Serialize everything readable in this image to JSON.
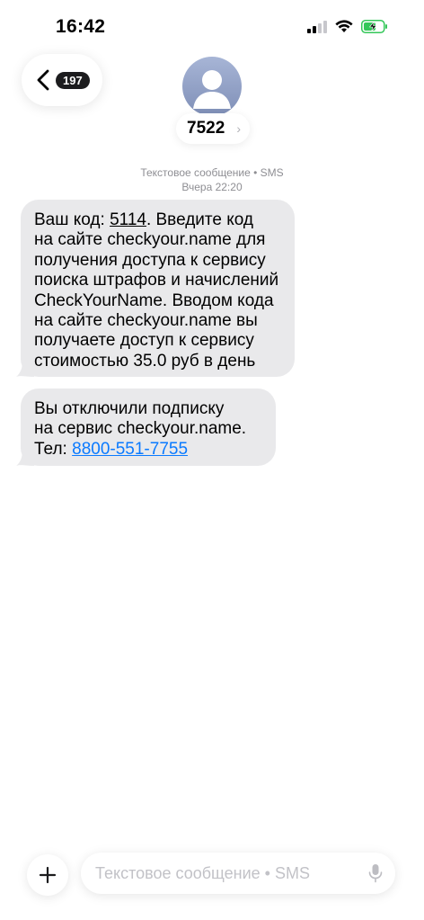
{
  "status_bar": {
    "time": "16:42",
    "icons": [
      "signal-icon",
      "wifi-icon",
      "battery-charging-icon"
    ],
    "battery_color": "#34c759"
  },
  "header": {
    "back_icon": "chevron-back-icon",
    "unread_count": "197",
    "contact_name": "7522",
    "contact_chevron": "›",
    "avatar_icon": "person-icon"
  },
  "thread": {
    "service_label": "Текстовое сообщение • SMS",
    "timestamp": "Вчера 22:20",
    "messages": [
      {
        "direction": "incoming",
        "lines": [
          {
            "prefix": "Ваш код: ",
            "code": "5114",
            "suffix": ". Введите код"
          },
          "на сайте checkyour.name для",
          "получения доступа к сервису",
          "поиска штрафов и начислений",
          "CheckYourName. Вводом кода",
          "на сайте checkyour.name вы",
          "получаете доступ к сервису",
          "стоимостью 35.0 руб в день"
        ]
      },
      {
        "direction": "incoming",
        "lines": [
          "Вы отключили подписку",
          "на сервис checkyour.name.",
          {
            "prefix": "Тел: ",
            "link": "8800-551-7755"
          }
        ]
      }
    ]
  },
  "composer": {
    "add_icon": "plus-icon",
    "placeholder": "Текстовое сообщение • SMS",
    "mic_icon": "mic-icon"
  },
  "colors": {
    "bubble_incoming": "#e9e9eb",
    "link": "#0a7aff",
    "secondary_text": "#8e8e93"
  }
}
